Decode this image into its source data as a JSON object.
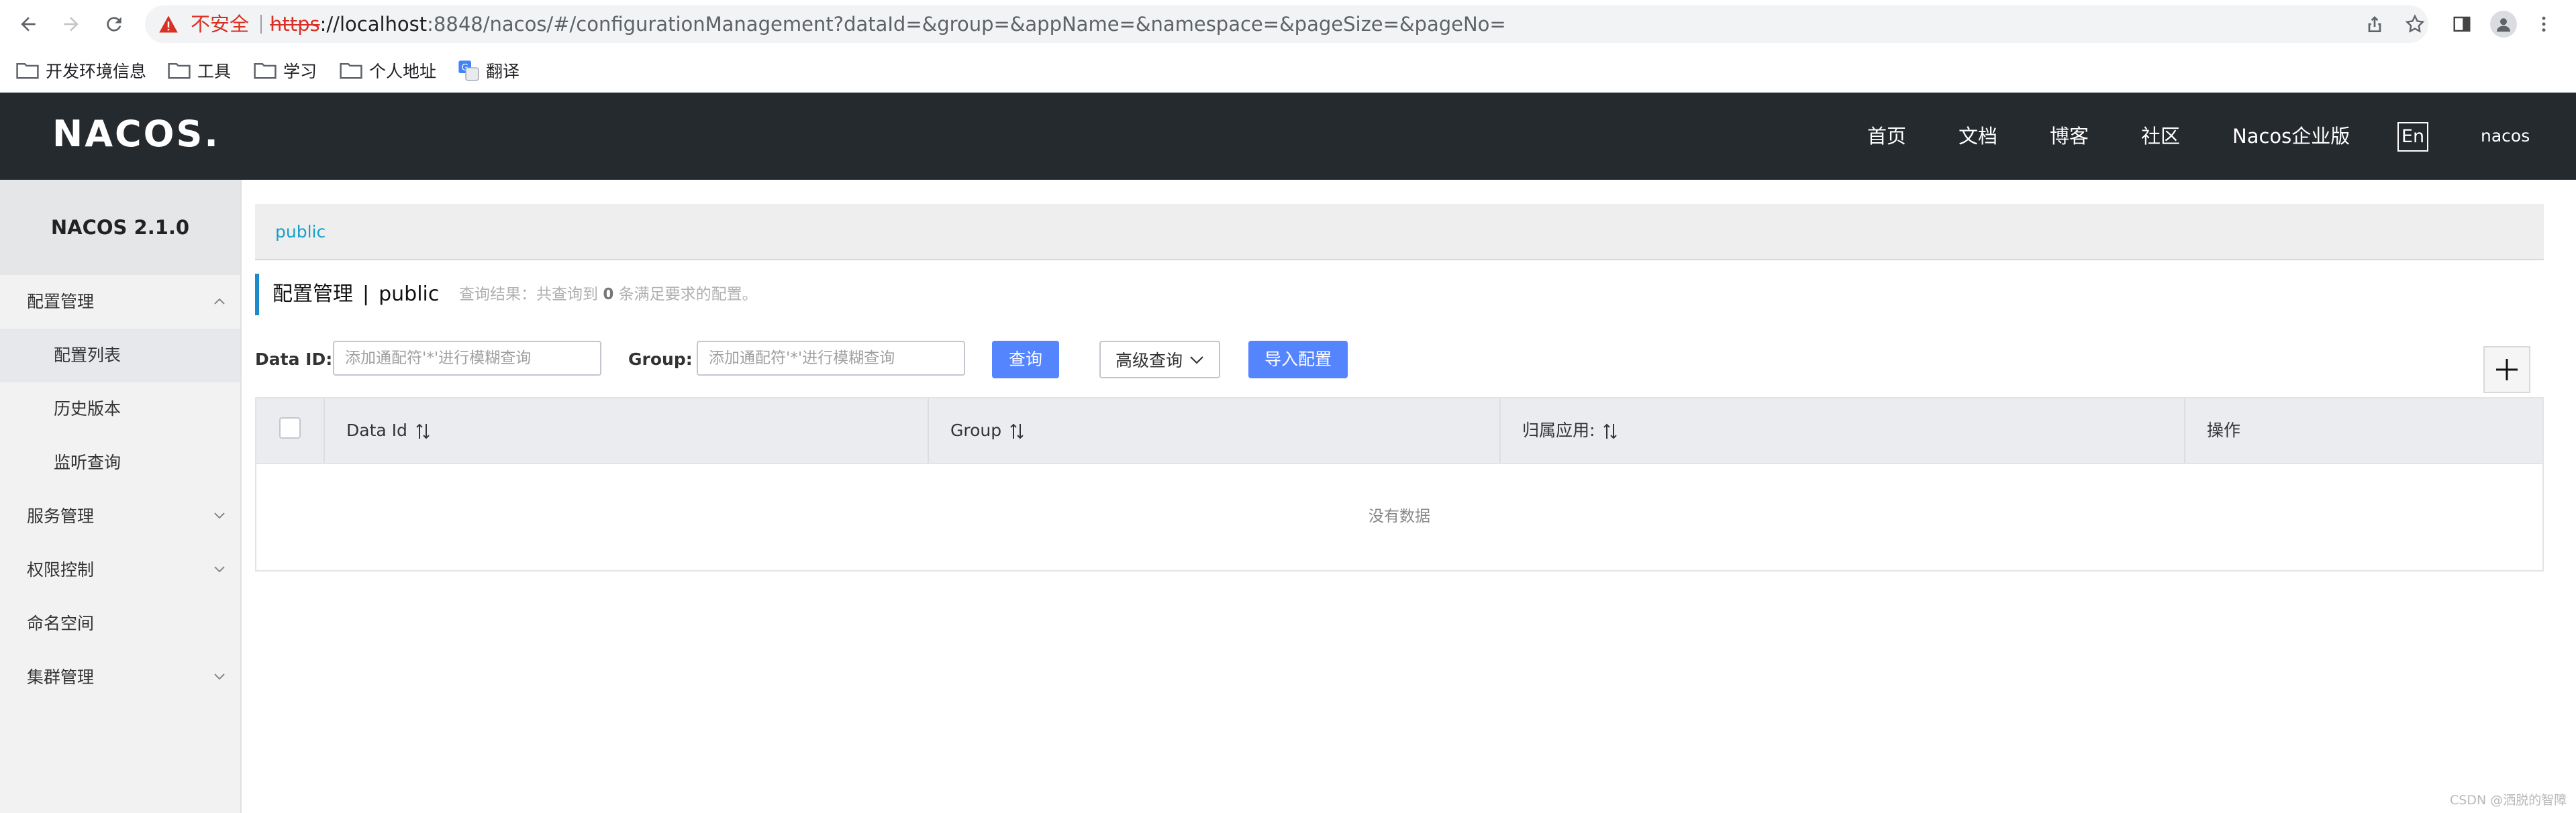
{
  "browser": {
    "insecure_label": "不安全",
    "url_protocol": "https",
    "url_host": "://localhost",
    "url_rest": ":8848/nacos/#/configurationManagement?dataId=&group=&appName=&namespace=&pageSize=&pageNo=",
    "bookmarks": [
      "开发环境信息",
      "工具",
      "学习",
      "个人地址",
      "翻译"
    ]
  },
  "header": {
    "logo": "NACOS.",
    "nav": [
      "首页",
      "文档",
      "博客",
      "社区",
      "Nacos企业版"
    ],
    "lang_button": "En",
    "user": "nacos"
  },
  "sidebar": {
    "version": "NACOS 2.1.0",
    "items": [
      {
        "label": "配置管理",
        "expanded": true
      },
      {
        "label": "配置列表",
        "active": true
      },
      {
        "label": "历史版本"
      },
      {
        "label": "监听查询"
      },
      {
        "label": "服务管理",
        "expanded": false
      },
      {
        "label": "权限控制",
        "expanded": false
      },
      {
        "label": "命名空间"
      },
      {
        "label": "集群管理",
        "expanded": false
      }
    ]
  },
  "main": {
    "namespace_tab": "public",
    "title": "配置管理",
    "title_sep": "|",
    "title_namespace": "public",
    "result_prefix": "查询结果：共查询到",
    "result_count": "0",
    "result_suffix": "条满足要求的配置。",
    "filters": {
      "data_id_label": "Data ID:",
      "data_id_placeholder": "添加通配符'*'进行模糊查询",
      "data_id_value": "",
      "group_label": "Group:",
      "group_placeholder": "添加通配符'*'进行模糊查询",
      "group_value": "",
      "query_button": "查询",
      "advanced_button": "高级查询",
      "import_button": "导入配置"
    },
    "table": {
      "columns": [
        "Data Id",
        "Group",
        "归属应用:",
        "操作"
      ],
      "empty_text": "没有数据"
    }
  },
  "watermark": "CSDN @洒脱的智障",
  "colors": {
    "header_bg": "#252a2f",
    "primary": "#5584ff",
    "link": "#16a0cb",
    "accent": "#1f8acb",
    "insecure": "#d93025"
  }
}
